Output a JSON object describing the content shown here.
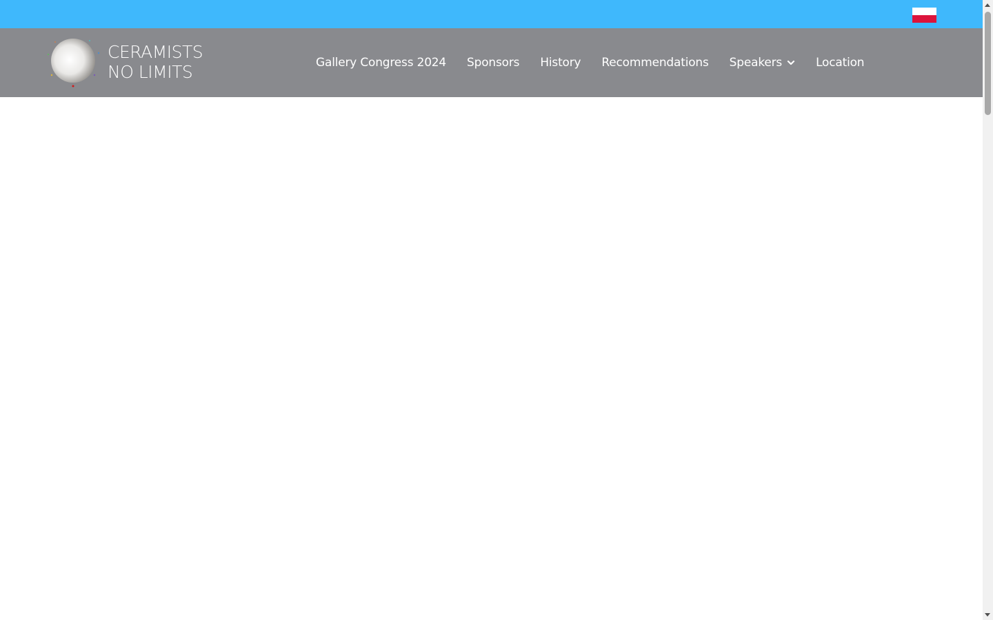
{
  "topbar": {
    "language_flag": "poland-flag-icon",
    "color": "#3fb8fc"
  },
  "header": {
    "color": "#898a8e",
    "logo": {
      "line1": "CERAMISTS",
      "line2": "NO LIMITS"
    },
    "nav": [
      {
        "label": "Gallery Congress 2024"
      },
      {
        "label": "Sponsors"
      },
      {
        "label": "History"
      },
      {
        "label": "Recommendations"
      },
      {
        "label": "Speakers",
        "has_dropdown": true
      },
      {
        "label": "Location"
      }
    ]
  }
}
